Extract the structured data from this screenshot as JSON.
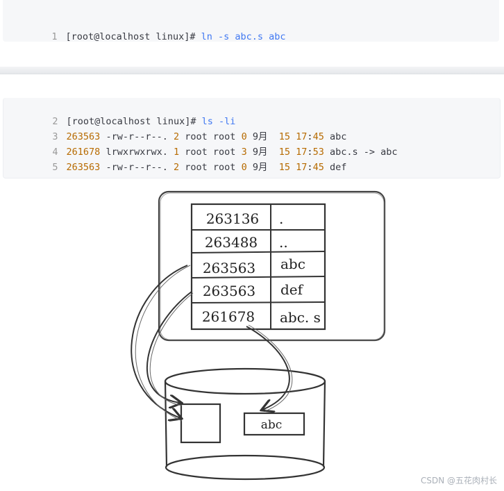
{
  "code_block_1": {
    "lines": [
      {
        "num": "1",
        "prompt": "[root@localhost linux]#",
        "command": "ln -s abc.s abc"
      }
    ]
  },
  "code_block_2": {
    "prompt_line": {
      "num": "2",
      "prompt": "[root@localhost linux]#",
      "command": "ls -li"
    },
    "rows": [
      {
        "num": "3",
        "inode": "263563",
        "perms": "-rw-r--r--.",
        "links": "2",
        "owner": "root root",
        "size": "0",
        "month": "9月",
        "day": "15",
        "hour": "17",
        "minute": "45",
        "name": "abc"
      },
      {
        "num": "4",
        "inode": "261678",
        "perms": "lrwxrwxrwx.",
        "links": "1",
        "owner": "root root",
        "size": "3",
        "month": "9月",
        "day": "15",
        "hour": "17",
        "minute": "53",
        "name": "abc.s -> abc"
      },
      {
        "num": "5",
        "inode": "263563",
        "perms": "-rw-r--r--.",
        "links": "2",
        "owner": "root root",
        "size": "0",
        "month": "9月",
        "day": "15",
        "hour": "17",
        "minute": "45",
        "name": "def"
      }
    ]
  },
  "diagram": {
    "directory_entries": [
      {
        "inode": "263136",
        "name": "."
      },
      {
        "inode": "263488",
        "name": ".."
      },
      {
        "inode": "263563",
        "name": "abc"
      },
      {
        "inode": "263563",
        "name": "def"
      },
      {
        "inode": "261678",
        "name": "abc. s"
      }
    ],
    "disk_block_label": "abc"
  },
  "watermark": "CSDN @五花肉村长",
  "colors": {
    "code_bg": "#f6f7f9",
    "command": "#4078f2",
    "number": "#b76b01",
    "line_number": "#999999",
    "sketch_stroke": "#333333"
  }
}
